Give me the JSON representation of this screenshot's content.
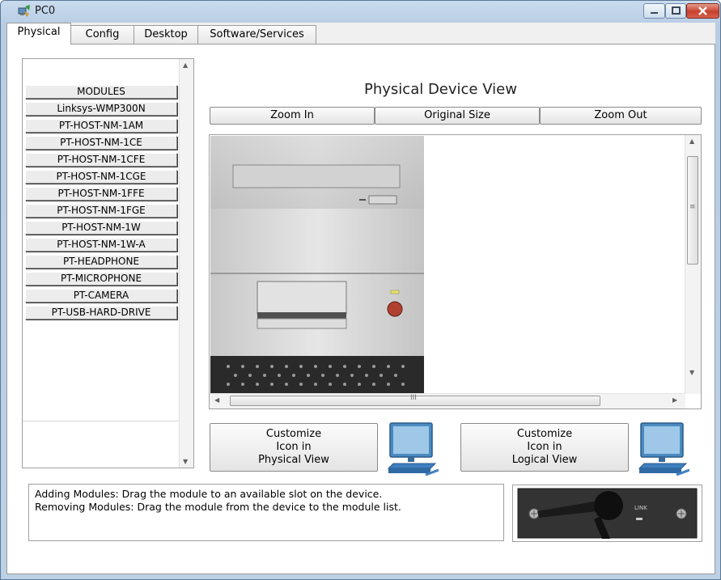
{
  "window": {
    "title": "PC0",
    "title_icon": "pc-icon",
    "controls": [
      "minimize-icon",
      "maximize-icon",
      "close-icon"
    ]
  },
  "tabs": [
    {
      "label": "Physical",
      "active": true
    },
    {
      "label": "Config"
    },
    {
      "label": "Desktop"
    },
    {
      "label": "Software/Services"
    }
  ],
  "modules": {
    "items": [
      "MODULES",
      "Linksys-WMP300N",
      "PT-HOST-NM-1AM",
      "PT-HOST-NM-1CE",
      "PT-HOST-NM-1CFE",
      "PT-HOST-NM-1CGE",
      "PT-HOST-NM-1FFE",
      "PT-HOST-NM-1FGE",
      "PT-HOST-NM-1W",
      "PT-HOST-NM-1W-A",
      "PT-HEADPHONE",
      "PT-MICROPHONE",
      "PT-CAMERA",
      "PT-USB-HARD-DRIVE"
    ]
  },
  "physical_view": {
    "title": "Physical Device View",
    "zoom_in": "Zoom In",
    "original_size": "Original Size",
    "zoom_out": "Zoom Out"
  },
  "customize": {
    "physical": [
      "Customize",
      "Icon in",
      "Physical View"
    ],
    "logical": [
      "Customize",
      "Icon in",
      "Logical View"
    ]
  },
  "info": {
    "line1": "Adding Modules: Drag the module to an available slot on the device.",
    "line2": "Removing Modules: Drag the module from the device to the module list."
  },
  "module_image": {
    "label": "LINK"
  },
  "colors": {
    "accent": "#3f7fbf",
    "window_frame": "#b8cde4",
    "close_button": "#c7412e"
  }
}
